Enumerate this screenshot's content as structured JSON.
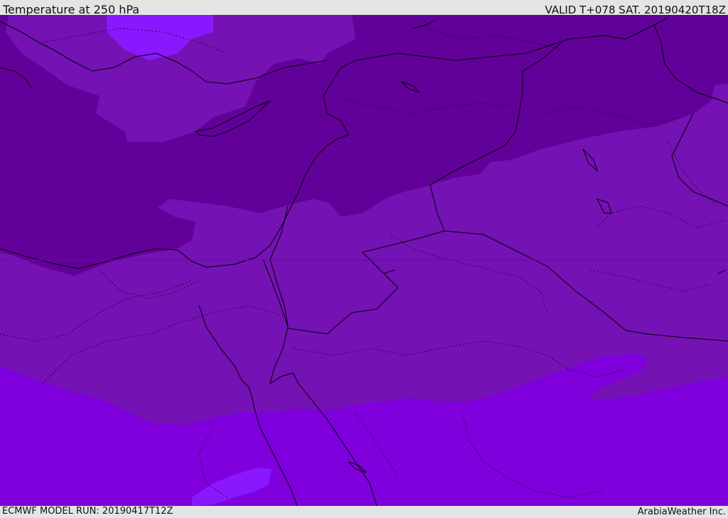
{
  "header": {
    "title": "Temperature at 250 hPa",
    "valid_time": "VALID T+078 SAT. 20190420T18Z"
  },
  "footer": {
    "model_run": "ECMWF MODEL RUN: 20190417T12Z",
    "credit": "ArabiaWeather Inc."
  },
  "colors": {
    "coldest_band": "#62009a",
    "cold_band": "#7412b4",
    "mild_band": "#7f00dc",
    "warm_patch": "#8a18ff",
    "coastline": "#000000"
  }
}
